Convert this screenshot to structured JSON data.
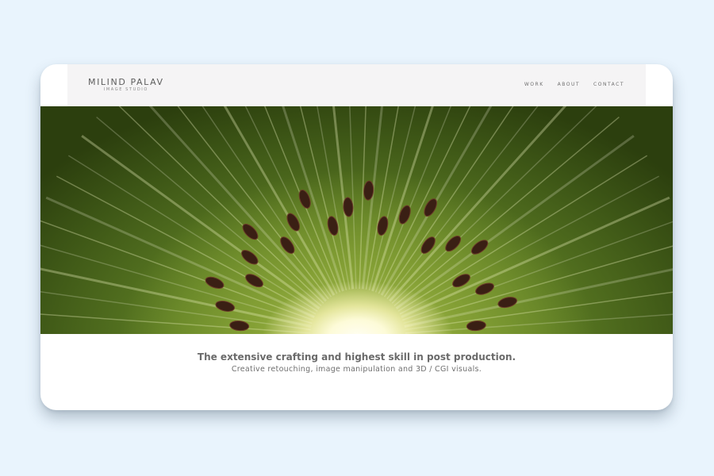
{
  "brand": {
    "name": "MILIND PALAV",
    "subtitle": "IMAGE STUDIO"
  },
  "nav": {
    "items": [
      {
        "label": "WORK"
      },
      {
        "label": "ABOUT"
      },
      {
        "label": "CONTACT"
      }
    ]
  },
  "hero": {
    "image_subject": "kiwi fruit cross-section macro"
  },
  "content": {
    "headline": "The extensive crafting and highest skill in post production.",
    "subheadline": "Creative retouching, image manipulation and 3D / CGI visuals."
  },
  "colors": {
    "page_background": "#e9f4fd",
    "header_background": "#f5f4f5",
    "text_gray": "#6a6a6a",
    "kiwi_green": "#5d7d24"
  }
}
